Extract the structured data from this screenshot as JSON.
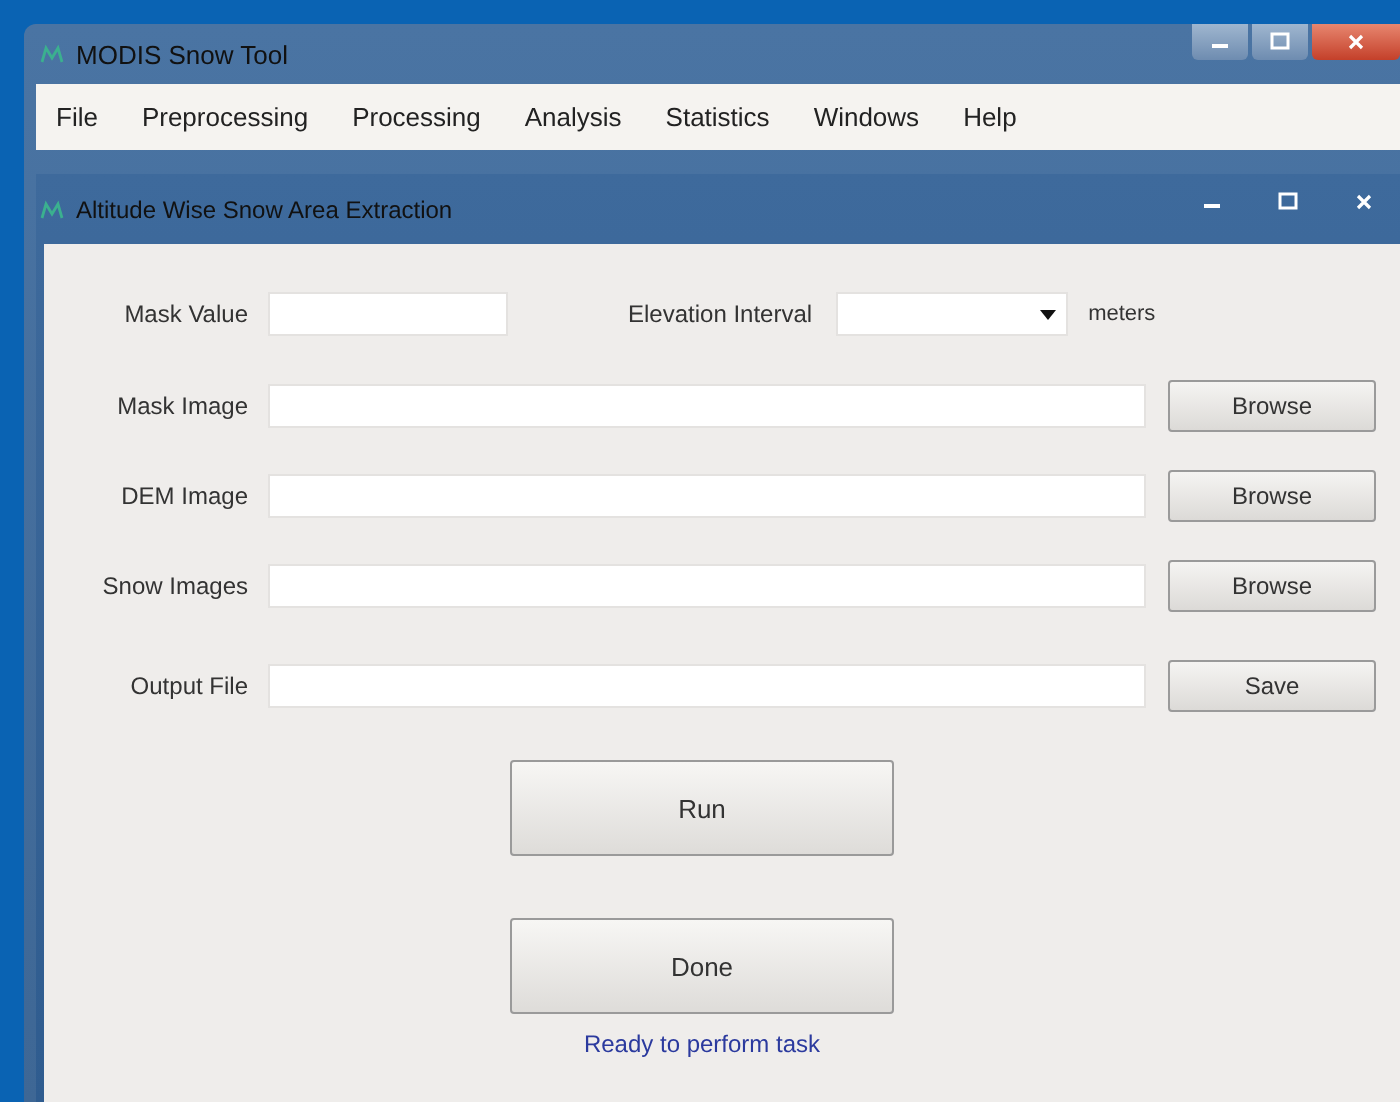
{
  "window": {
    "title": "MODIS Snow Tool"
  },
  "menu": [
    "File",
    "Preprocessing",
    "Processing",
    "Analysis",
    "Statistics",
    "Windows",
    "Help"
  ],
  "dialog": {
    "title": "Altitude Wise Snow Area Extraction"
  },
  "mask_value": {
    "label": "Mask Value"
  },
  "elevation_interval": {
    "label": "Elevation Interval",
    "unit": "meters"
  },
  "file_rows": [
    {
      "label": "Mask Image",
      "button": "Browse"
    },
    {
      "label": "DEM Image",
      "button": "Browse"
    },
    {
      "label": "Snow Images",
      "button": "Browse"
    },
    {
      "label": "Output File",
      "button": "Save"
    }
  ],
  "actions": [
    "Run",
    "Done"
  ],
  "status": "Ready to perform task"
}
